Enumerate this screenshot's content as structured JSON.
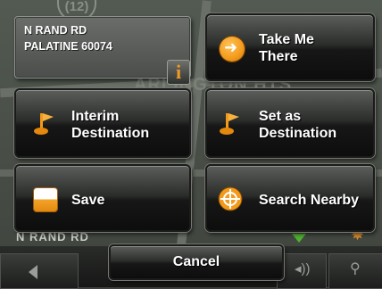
{
  "map": {
    "route_number": "(12)",
    "city_label": "ARLINGTON HTS",
    "current_road": "N RAND RD"
  },
  "address": {
    "line1": "N RAND RD",
    "line2": "PALATINE 60074",
    "info_icon": "info-icon",
    "info_glyph": "i"
  },
  "buttons": {
    "take_me_there": {
      "line1": "Take Me",
      "line2": "There",
      "icon": "arrow-right-circle-icon"
    },
    "interim_destination": {
      "line1": "Interim",
      "line2": "Destination",
      "icon": "flag-icon"
    },
    "set_as_destination": {
      "line1": "Set as",
      "line2": "Destination",
      "icon": "flag-icon"
    },
    "save": {
      "label": "Save",
      "icon": "save-icon"
    },
    "search_nearby": {
      "label": "Search Nearby",
      "icon": "target-icon"
    },
    "cancel": {
      "label": "Cancel"
    }
  },
  "colors": {
    "accent_orange": "#f39a1b",
    "button_dark": "#161716",
    "text": "#ffffff"
  }
}
